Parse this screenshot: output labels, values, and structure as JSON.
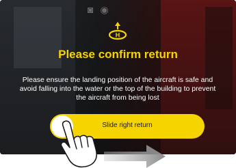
{
  "dialog": {
    "title": "Please confirm return",
    "message": "Please ensure the landing position of the aircraft is safe and avoid falling into the water or the top of the building to prevent the aircraft from being lost",
    "return_icon": "return-home-icon",
    "status_icons": [
      "camera-icon",
      "record-icon"
    ]
  },
  "slider": {
    "label": "Slide right return",
    "icon": "hand-pointer-icon",
    "arrow_icon": "arrow-right-icon"
  },
  "colors": {
    "accent": "#f5d400",
    "text": "#ffffff",
    "overlay": "#000000"
  }
}
